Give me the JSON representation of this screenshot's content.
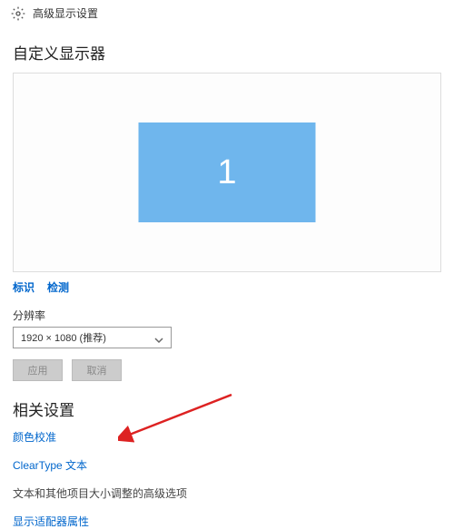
{
  "header": {
    "title": "高级显示设置"
  },
  "main": {
    "heading": "自定义显示器",
    "monitor_number": "1",
    "identify_link": "标识",
    "detect_link": "检测",
    "resolution_label": "分辨率",
    "resolution_value": "1920 × 1080 (推荐)",
    "apply_button": "应用",
    "cancel_button": "取消"
  },
  "related": {
    "heading": "相关设置",
    "links": {
      "color_calibration": "颜色校准",
      "cleartype": "ClearType 文本",
      "text_sizing": "文本和其他项目大小调整的高级选项",
      "adapter_properties": "显示适配器属性"
    }
  }
}
